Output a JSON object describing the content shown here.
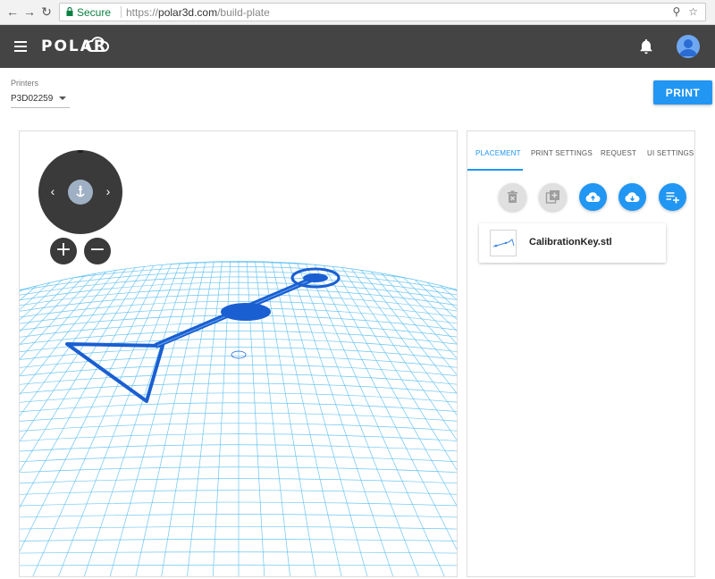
{
  "browser": {
    "secure_label": "Secure",
    "url_scheme": "https://",
    "url_host": "polar3d.com",
    "url_path": "/build-plate"
  },
  "header": {
    "logo_text": "POLAR"
  },
  "printer": {
    "label": "Printers",
    "selected": "P3D02259"
  },
  "print_button_label": "PRINT",
  "viewport": {
    "zoom_in_label": "+",
    "zoom_out_label": "−"
  },
  "panel": {
    "tabs": [
      {
        "label": "PLACEMENT",
        "active": true
      },
      {
        "label": "PRINT SETTINGS",
        "active": false
      },
      {
        "label": "REQUEST",
        "active": false
      },
      {
        "label": "UI SETTINGS",
        "active": false
      }
    ],
    "actions": [
      {
        "icon": "delete-icon",
        "enabled": false
      },
      {
        "icon": "duplicate-icon",
        "enabled": false
      },
      {
        "icon": "cloud-upload-icon",
        "enabled": true
      },
      {
        "icon": "cloud-download-icon",
        "enabled": true
      },
      {
        "icon": "playlist-add-icon",
        "enabled": true
      }
    ],
    "files": [
      {
        "name": "CalibrationKey.stl"
      }
    ]
  },
  "colors": {
    "accent": "#2196f3",
    "header_bg": "#444444",
    "grid": "#5ec0f2",
    "model": "#1a5fd1"
  }
}
